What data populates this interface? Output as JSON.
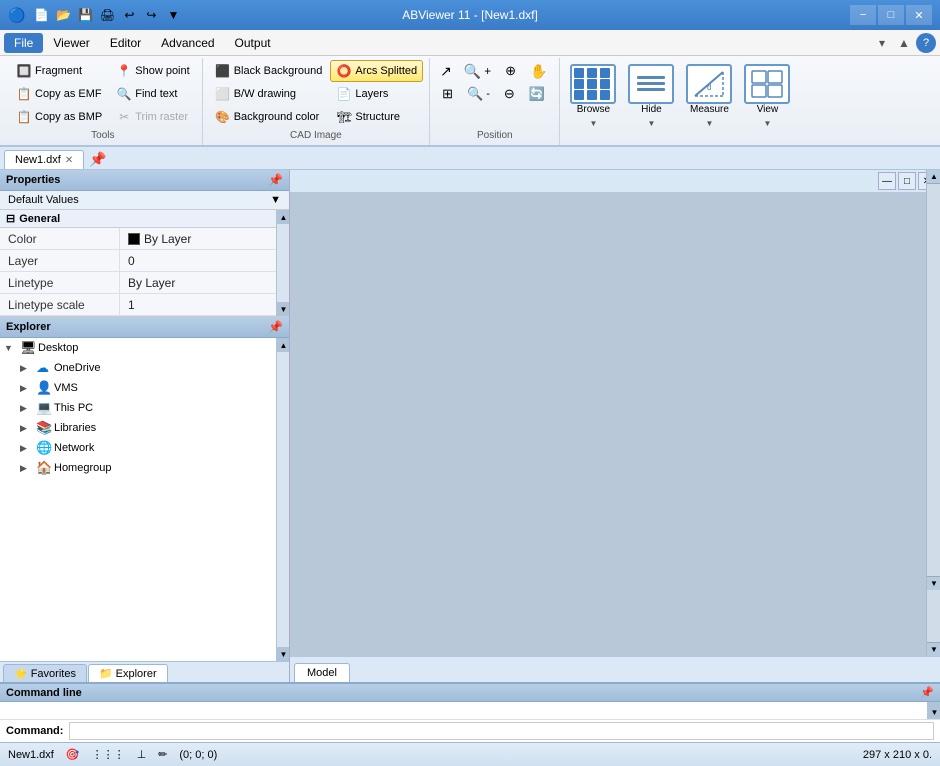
{
  "titlebar": {
    "title": "ABViewer 11 - [New1.dxf]",
    "min": "−",
    "max": "□",
    "close": "✕"
  },
  "menubar": {
    "items": [
      "File",
      "Viewer",
      "Editor",
      "Advanced",
      "Output"
    ]
  },
  "ribbon": {
    "groups": [
      {
        "label": "Tools",
        "buttons_small": [
          {
            "label": "Fragment",
            "icon": "🔲"
          },
          {
            "label": "Copy as EMF",
            "icon": "📋"
          },
          {
            "label": "Copy as BMP",
            "icon": "📋"
          },
          {
            "label": "Show point",
            "icon": "📍"
          },
          {
            "label": "Find text",
            "icon": "🔍"
          },
          {
            "label": "Trim raster",
            "icon": "✂"
          }
        ]
      },
      {
        "label": "CAD Image",
        "buttons_small": [
          {
            "label": "Black Background",
            "icon": "⬛"
          },
          {
            "label": "B/W drawing",
            "icon": "⬜"
          },
          {
            "label": "Background color",
            "icon": "🎨"
          },
          {
            "label": "Arcs Splitted",
            "icon": "⭕",
            "active": true
          },
          {
            "label": "Layers",
            "icon": "📄"
          },
          {
            "label": "Structure",
            "icon": "🏗"
          }
        ]
      },
      {
        "label": "Position",
        "buttons": [
          {
            "icon": "↗",
            "label": ""
          },
          {
            "icon": "🔍+",
            "label": ""
          },
          {
            "icon": "🔍-",
            "label": ""
          },
          {
            "icon": "✋",
            "label": ""
          }
        ]
      },
      {
        "label": "",
        "large_buttons": [
          {
            "label": "Browse",
            "type": "browse"
          },
          {
            "label": "Hide",
            "type": "hide"
          },
          {
            "label": "Measure",
            "type": "measure"
          },
          {
            "label": "View",
            "type": "view"
          }
        ]
      }
    ]
  },
  "tabs": [
    {
      "label": "New1.dxf",
      "active": true,
      "closeable": true
    }
  ],
  "properties": {
    "header": "Properties",
    "pin_icon": "📌",
    "section_label": "Default Values",
    "general_label": "General",
    "rows": [
      {
        "key": "Color",
        "value": "By Layer",
        "has_swatch": true
      },
      {
        "key": "Layer",
        "value": "0"
      },
      {
        "key": "Linetype",
        "value": "By Layer"
      },
      {
        "key": "Linetype scale",
        "value": "1"
      }
    ]
  },
  "explorer": {
    "header": "Explorer",
    "pin_icon": "📌",
    "items": [
      {
        "label": "Desktop",
        "indent": 0,
        "expanded": true,
        "icon": "🖥",
        "selected": false
      },
      {
        "label": "OneDrive",
        "indent": 1,
        "expanded": false,
        "icon": "☁",
        "selected": false
      },
      {
        "label": "VMS",
        "indent": 1,
        "expanded": false,
        "icon": "👤",
        "selected": false
      },
      {
        "label": "This PC",
        "indent": 1,
        "expanded": false,
        "icon": "💻",
        "selected": false
      },
      {
        "label": "Libraries",
        "indent": 1,
        "expanded": false,
        "icon": "📚",
        "selected": false
      },
      {
        "label": "Network",
        "indent": 1,
        "expanded": false,
        "icon": "🌐",
        "selected": false
      },
      {
        "label": "Homegroup",
        "indent": 1,
        "expanded": false,
        "icon": "🏠",
        "selected": false
      }
    ],
    "tabs": [
      {
        "label": "Favorites",
        "icon": "⭐",
        "active": false
      },
      {
        "label": "Explorer",
        "icon": "📁",
        "active": true
      }
    ]
  },
  "canvas": {
    "mini_buttons": [
      "—",
      "□",
      "✕"
    ]
  },
  "model_tabs": [
    {
      "label": "Model",
      "active": true
    }
  ],
  "command_line": {
    "header": "Command line",
    "pin_icon": "📌",
    "label": "Command:"
  },
  "statusbar": {
    "filename": "New1.dxf",
    "coords": "(0; 0; 0)",
    "dimensions": "297 x 210 x 0.",
    "icons": [
      "🎯",
      "⋮⋮⋮",
      "⊥",
      "✏"
    ]
  }
}
